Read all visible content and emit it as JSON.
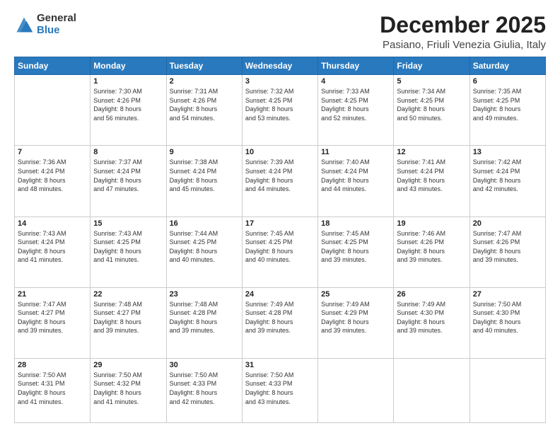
{
  "logo": {
    "general": "General",
    "blue": "Blue"
  },
  "header": {
    "month": "December 2025",
    "location": "Pasiano, Friuli Venezia Giulia, Italy"
  },
  "weekdays": [
    "Sunday",
    "Monday",
    "Tuesday",
    "Wednesday",
    "Thursday",
    "Friday",
    "Saturday"
  ],
  "weeks": [
    [
      {
        "day": "",
        "info": ""
      },
      {
        "day": "1",
        "info": "Sunrise: 7:30 AM\nSunset: 4:26 PM\nDaylight: 8 hours\nand 56 minutes."
      },
      {
        "day": "2",
        "info": "Sunrise: 7:31 AM\nSunset: 4:26 PM\nDaylight: 8 hours\nand 54 minutes."
      },
      {
        "day": "3",
        "info": "Sunrise: 7:32 AM\nSunset: 4:25 PM\nDaylight: 8 hours\nand 53 minutes."
      },
      {
        "day": "4",
        "info": "Sunrise: 7:33 AM\nSunset: 4:25 PM\nDaylight: 8 hours\nand 52 minutes."
      },
      {
        "day": "5",
        "info": "Sunrise: 7:34 AM\nSunset: 4:25 PM\nDaylight: 8 hours\nand 50 minutes."
      },
      {
        "day": "6",
        "info": "Sunrise: 7:35 AM\nSunset: 4:25 PM\nDaylight: 8 hours\nand 49 minutes."
      }
    ],
    [
      {
        "day": "7",
        "info": "Sunrise: 7:36 AM\nSunset: 4:24 PM\nDaylight: 8 hours\nand 48 minutes."
      },
      {
        "day": "8",
        "info": "Sunrise: 7:37 AM\nSunset: 4:24 PM\nDaylight: 8 hours\nand 47 minutes."
      },
      {
        "day": "9",
        "info": "Sunrise: 7:38 AM\nSunset: 4:24 PM\nDaylight: 8 hours\nand 45 minutes."
      },
      {
        "day": "10",
        "info": "Sunrise: 7:39 AM\nSunset: 4:24 PM\nDaylight: 8 hours\nand 44 minutes."
      },
      {
        "day": "11",
        "info": "Sunrise: 7:40 AM\nSunset: 4:24 PM\nDaylight: 8 hours\nand 44 minutes."
      },
      {
        "day": "12",
        "info": "Sunrise: 7:41 AM\nSunset: 4:24 PM\nDaylight: 8 hours\nand 43 minutes."
      },
      {
        "day": "13",
        "info": "Sunrise: 7:42 AM\nSunset: 4:24 PM\nDaylight: 8 hours\nand 42 minutes."
      }
    ],
    [
      {
        "day": "14",
        "info": "Sunrise: 7:43 AM\nSunset: 4:24 PM\nDaylight: 8 hours\nand 41 minutes."
      },
      {
        "day": "15",
        "info": "Sunrise: 7:43 AM\nSunset: 4:25 PM\nDaylight: 8 hours\nand 41 minutes."
      },
      {
        "day": "16",
        "info": "Sunrise: 7:44 AM\nSunset: 4:25 PM\nDaylight: 8 hours\nand 40 minutes."
      },
      {
        "day": "17",
        "info": "Sunrise: 7:45 AM\nSunset: 4:25 PM\nDaylight: 8 hours\nand 40 minutes."
      },
      {
        "day": "18",
        "info": "Sunrise: 7:45 AM\nSunset: 4:25 PM\nDaylight: 8 hours\nand 39 minutes."
      },
      {
        "day": "19",
        "info": "Sunrise: 7:46 AM\nSunset: 4:26 PM\nDaylight: 8 hours\nand 39 minutes."
      },
      {
        "day": "20",
        "info": "Sunrise: 7:47 AM\nSunset: 4:26 PM\nDaylight: 8 hours\nand 39 minutes."
      }
    ],
    [
      {
        "day": "21",
        "info": "Sunrise: 7:47 AM\nSunset: 4:27 PM\nDaylight: 8 hours\nand 39 minutes."
      },
      {
        "day": "22",
        "info": "Sunrise: 7:48 AM\nSunset: 4:27 PM\nDaylight: 8 hours\nand 39 minutes."
      },
      {
        "day": "23",
        "info": "Sunrise: 7:48 AM\nSunset: 4:28 PM\nDaylight: 8 hours\nand 39 minutes."
      },
      {
        "day": "24",
        "info": "Sunrise: 7:49 AM\nSunset: 4:28 PM\nDaylight: 8 hours\nand 39 minutes."
      },
      {
        "day": "25",
        "info": "Sunrise: 7:49 AM\nSunset: 4:29 PM\nDaylight: 8 hours\nand 39 minutes."
      },
      {
        "day": "26",
        "info": "Sunrise: 7:49 AM\nSunset: 4:30 PM\nDaylight: 8 hours\nand 39 minutes."
      },
      {
        "day": "27",
        "info": "Sunrise: 7:50 AM\nSunset: 4:30 PM\nDaylight: 8 hours\nand 40 minutes."
      }
    ],
    [
      {
        "day": "28",
        "info": "Sunrise: 7:50 AM\nSunset: 4:31 PM\nDaylight: 8 hours\nand 41 minutes."
      },
      {
        "day": "29",
        "info": "Sunrise: 7:50 AM\nSunset: 4:32 PM\nDaylight: 8 hours\nand 41 minutes."
      },
      {
        "day": "30",
        "info": "Sunrise: 7:50 AM\nSunset: 4:33 PM\nDaylight: 8 hours\nand 42 minutes."
      },
      {
        "day": "31",
        "info": "Sunrise: 7:50 AM\nSunset: 4:33 PM\nDaylight: 8 hours\nand 43 minutes."
      },
      {
        "day": "",
        "info": ""
      },
      {
        "day": "",
        "info": ""
      },
      {
        "day": "",
        "info": ""
      }
    ]
  ]
}
